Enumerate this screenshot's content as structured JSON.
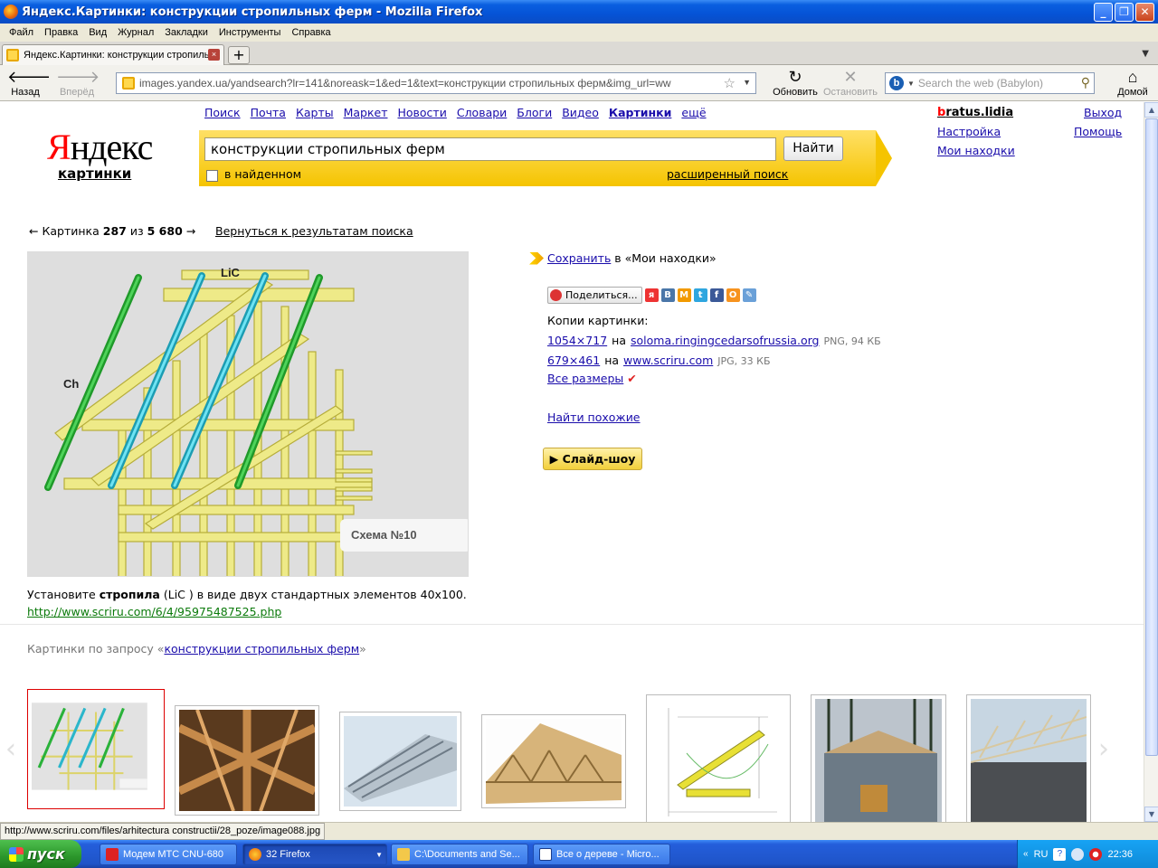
{
  "window": {
    "title": "Яндекс.Картинки: конструкции стропильных ферм - Mozilla Firefox",
    "controls": {
      "minimize": "_",
      "maximize": "❐",
      "close": "✕"
    }
  },
  "menu": [
    "Файл",
    "Правка",
    "Вид",
    "Журнал",
    "Закладки",
    "Инструменты",
    "Справка"
  ],
  "tab": {
    "title": "Яндекс.Картинки: конструкции стропиль...",
    "close": "×",
    "new_tab": "+"
  },
  "nav": {
    "back": "Назад",
    "forward": "Вперёд",
    "url": "images.yandex.ua/yandsearch?lr=141&noreask=1&ed=1&text=конструкции стропильных ферм&img_url=ww",
    "reload": "Обновить",
    "stop": "Остановить",
    "search_placeholder": "Search the web (Babylon)",
    "home": "Домой"
  },
  "yandex": {
    "logo_first": "Я",
    "logo_rest": "ндекс",
    "section": "картинки",
    "services": [
      "Поиск",
      "Почта",
      "Карты",
      "Маркет",
      "Новости",
      "Словари",
      "Блоги",
      "Видео",
      "Картинки",
      "ещё"
    ],
    "active_service": "Картинки",
    "query": "конструкции стропильных ферм",
    "search_button": "Найти",
    "in_found": "в найденном",
    "advanced": "расширенный поиск",
    "user_first": "b",
    "user_rest": "ratus.lidia",
    "settings": "Настройка",
    "my_finds": "Мои находки",
    "logout": "Выход",
    "help": "Помощь"
  },
  "viewer": {
    "prev_arrow": "←",
    "next_arrow": "→",
    "label": "Картинка",
    "index": "287",
    "of": "из",
    "total": "5 680",
    "back_to_results": "Вернуться к результатам поиска",
    "image_labels": {
      "lic": "LiC",
      "ch": "Ch",
      "scheme": "Схема №10"
    },
    "caption_prefix": "Установите ",
    "caption_bold": "стропила",
    "caption_suffix": " (LiC ) в виде двух стандартных элементов 40x100.",
    "source_url": "http://www.scriru.com/6/4/95975487525.php"
  },
  "sidebar": {
    "save_link": "Сохранить",
    "save_rest": "в «Мои находки»",
    "share_button": "Поделиться...",
    "share_icons": [
      "я",
      "В",
      "М",
      "t",
      "f",
      "О",
      "✎"
    ],
    "copies_title": "Копии картинки:",
    "copies": [
      {
        "size": "1054×717",
        "on": "на",
        "site": "soloma.ringingcedarsofrussia.org",
        "meta": "PNG, 94 КБ"
      },
      {
        "size": "679×461",
        "on": "на",
        "site": "www.scriru.com",
        "meta": "JPG, 33 КБ"
      }
    ],
    "all_sizes": "Все размеры",
    "all_sizes_mark": "✔",
    "find_similar": "Найти похожие",
    "slideshow": "Слайд-шоу"
  },
  "related": {
    "prefix": "Картинки по запросу «",
    "query": "конструкции стропильных ферм",
    "suffix": "»"
  },
  "carousel": {
    "left": "‹",
    "right": "›"
  },
  "status": "http://www.scriru.com/files/arhitectura constructii/28_poze/image088.jpg",
  "taskbar": {
    "start": "пуск",
    "tasks": [
      "Модем МТС CNU-680",
      "32 Firefox",
      "C:\\Documents and Se...",
      "Все о дереве - Micro..."
    ],
    "lang": "RU",
    "clock": "22:36"
  },
  "colors": {
    "yandex_yellow": "#f5c400",
    "link": "#1a0dab",
    "source_green": "#0b7a0b",
    "xp_blue": "#245edb"
  }
}
